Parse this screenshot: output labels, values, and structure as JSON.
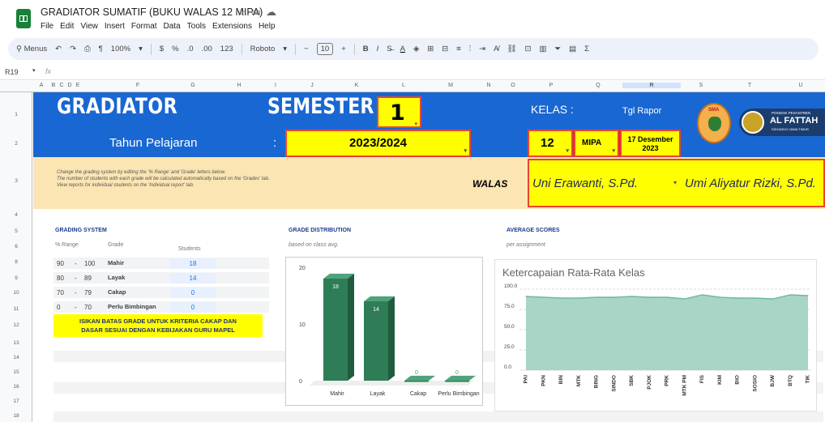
{
  "app": {
    "title": "GRADIATOR SUMATIF (BUKU WALAS 12 MIPA)",
    "menu": [
      "File",
      "Edit",
      "View",
      "Insert",
      "Format",
      "Data",
      "Tools",
      "Extensions",
      "Help"
    ]
  },
  "toolbar": {
    "menus": "Menus",
    "zoom": "100%",
    "currency": "$",
    "percent": "%",
    "dec_less": ".0",
    "dec_more": ".00",
    "num_fmt": "123",
    "font": "Roboto",
    "font_size": "10",
    "bold": "B",
    "italic": "I",
    "sigma": "Σ"
  },
  "formula_bar": {
    "cell": "R19",
    "fx": "fx"
  },
  "columns": [
    "A",
    "B",
    "C",
    "D",
    "E",
    "F",
    "G",
    "H",
    "I",
    "J",
    "K",
    "L",
    "M",
    "N",
    "O",
    "P",
    "Q",
    "R",
    "S",
    "T",
    "U"
  ],
  "rows": [
    "1",
    "2",
    "3",
    "4",
    "5",
    "6",
    "8",
    "9",
    "10",
    "11",
    "12",
    "13",
    "14",
    "15",
    "16",
    "17",
    "18"
  ],
  "header": {
    "title": "GRADIATOR",
    "semester_label": "SEMESTER",
    "semester_value": "1",
    "tahun_label": "Tahun Pelajaran",
    "colon": ":",
    "tahun_value": "2023/2024",
    "kelas_label": "KELAS :",
    "kelas_value": "12",
    "jurusan_value": "MIPA",
    "tgl_label": "Tgl Rapor",
    "tgl_value_1": "17 Desember",
    "tgl_value_2": "2023",
    "logo1_text": "SMA",
    "logo2_top": "PONDOK PESANTREN",
    "logo2_main": "AL FATTAH",
    "logo2_sub": "SIDOARJO JAWA TIMUR"
  },
  "info": {
    "line1": "Change the grading system by editing the '% Range' and 'Grade' letters below.",
    "line2": "The number of students with each grade will be calculated automatically based on the 'Grades' tab.",
    "line3": "View reports for individual students on the 'Individual report' tab.",
    "walas_label": "WALAS",
    "walas_1": "Uni Erawanti, S.Pd.",
    "walas_2": "Umi Aliyatur Rizki, S.Pd."
  },
  "grading": {
    "title": "GRADING SYSTEM",
    "col_range": "% Range",
    "col_grade": "Grade",
    "col_students": "Students",
    "rows": [
      {
        "min": "90",
        "sep": "-",
        "max": "100",
        "grade": "Mahir",
        "students": "18"
      },
      {
        "min": "80",
        "sep": "-",
        "max": "89",
        "grade": "Layak",
        "students": "14"
      },
      {
        "min": "70",
        "sep": "-",
        "max": "79",
        "grade": "Cakap",
        "students": "0"
      },
      {
        "min": "0",
        "sep": "-",
        "max": "70",
        "grade": "Perlu Bimbingan",
        "students": "0"
      }
    ],
    "note_1": "ISIKAN BATAS GRADE UNTUK KRITERIA CAKAP DAN",
    "note_2": "DASAR SESUAI DENGAN KEBIJAKAN GURU MAPEL"
  },
  "distribution": {
    "title": "GRADE DISTRIBUTION",
    "subtitle": "based on class avg."
  },
  "averages": {
    "title": "AVERAGE SCORES",
    "subtitle": "per assignment"
  },
  "chart_data": [
    {
      "type": "bar",
      "categories": [
        "Mahir",
        "Layak",
        "Cakap",
        "Perlu Bimbingan"
      ],
      "values": [
        18,
        14,
        0,
        0
      ],
      "ylim": [
        0,
        20
      ],
      "yticks": [
        "0",
        "10",
        "20"
      ],
      "color": "#2e7d57",
      "grid": false
    },
    {
      "type": "area",
      "title": "Ketercapaian Rata-Rata Kelas",
      "categories": [
        "PAI",
        "PKN",
        "BIN",
        "MTK",
        "BING",
        "SINDO",
        "SBK",
        "PJOK",
        "PRK",
        "MTK PM",
        "FIS",
        "KIM",
        "BIO",
        "SOSIO",
        "BJW",
        "BTQ",
        "TIK"
      ],
      "values": [
        91,
        90,
        89,
        89,
        90,
        90,
        91,
        90,
        90,
        88,
        93,
        90,
        89,
        89,
        88,
        93,
        92
      ],
      "ylim": [
        0,
        100
      ],
      "yticks": [
        "0.0",
        "25.0",
        "50.0",
        "75.0",
        "100.0"
      ],
      "color": "#a8d5c5",
      "line_color": "#6fb8a0",
      "grid": true
    }
  ]
}
